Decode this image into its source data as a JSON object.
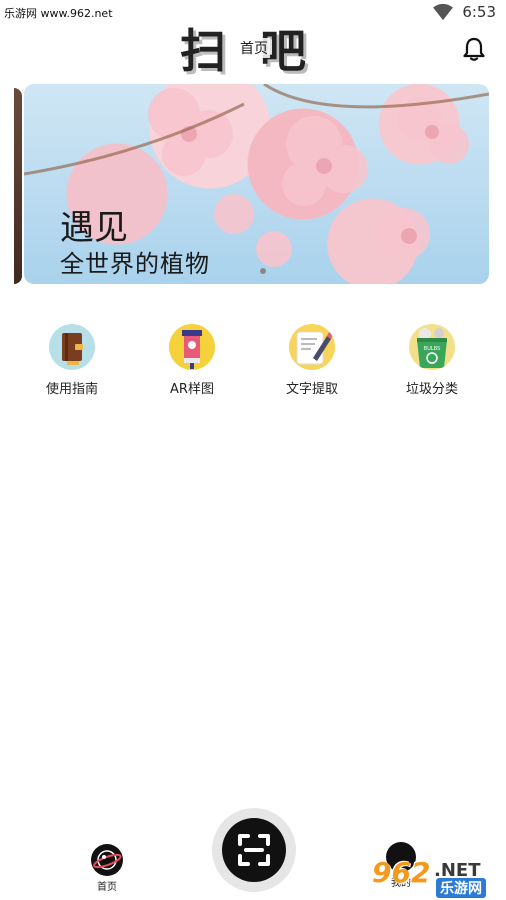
{
  "status_bar": {
    "watermark": "乐游网 www.962.net",
    "time": "6:53",
    "wifi_icon": "wifi-icon"
  },
  "header": {
    "logo": "扫吧",
    "title": "首页",
    "notification_icon": "bell-icon"
  },
  "banner": {
    "title": "遇见",
    "subtitle": "全世界的植物",
    "active_index": 0,
    "page_count": 2
  },
  "features": [
    {
      "label": "使用指南",
      "icon": "guide-book-icon"
    },
    {
      "label": "AR样图",
      "icon": "ar-sample-icon"
    },
    {
      "label": "文字提取",
      "icon": "text-extract-icon"
    },
    {
      "label": "垃圾分类",
      "icon": "garbage-sort-icon"
    }
  ],
  "bottom_nav": {
    "home_label": "首页",
    "mine_label": "我的",
    "scan_icon": "scan-icon"
  },
  "watermark_bottom": {
    "num": "962",
    "net": ".NET",
    "sub": "乐游网"
  },
  "colors": {
    "accent": "#111111",
    "watermark_orange": "#f39a1e",
    "watermark_blue": "#2b7bd6"
  }
}
